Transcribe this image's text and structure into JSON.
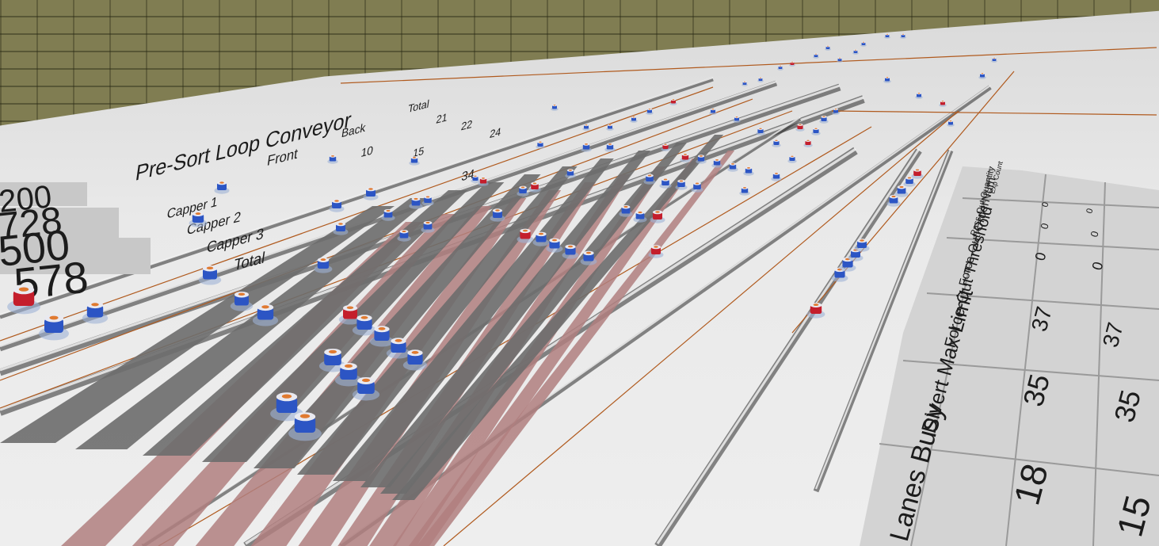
{
  "scene": {
    "title": "Pre-Sort Loop Conveyor",
    "column_headers": [
      "Front",
      "Back",
      "Total"
    ],
    "rows": [
      {
        "label": "Capper 1",
        "values": [
          "10",
          "",
          "21"
        ]
      },
      {
        "label": "Capper 2",
        "values": [
          "",
          "15",
          "22"
        ]
      },
      {
        "label": "Capper 3",
        "values": [
          "",
          "",
          "24"
        ]
      },
      {
        "label": "Total",
        "values": [
          "",
          "",
          "34"
        ]
      }
    ],
    "large_counters": [
      "200",
      "728",
      "500",
      "578"
    ],
    "lane_table": {
      "row_labels": [
        "Lanes Busy",
        "Divert Max Limit",
        "Force-Out Threshold",
        "Force-Out OrderNum",
        "Pass-Out Quantity",
        "Exp Count"
      ],
      "col1": [
        "18",
        "35",
        "37",
        "0",
        "0",
        "0"
      ],
      "col2": [
        "15",
        "35",
        "37",
        "0",
        "0",
        "0"
      ]
    },
    "colors": {
      "wall": "#807d52",
      "floor": "#e8e8e8",
      "conveyor": "#707070",
      "belt_shadow": "#2a2a2a",
      "lane_dark": "#6d6d6d",
      "lane_pink": "#b07f7f",
      "wire": "#b05a1e",
      "bottle_blue": "#2c55c4",
      "bottle_red": "#c41e2c"
    }
  }
}
